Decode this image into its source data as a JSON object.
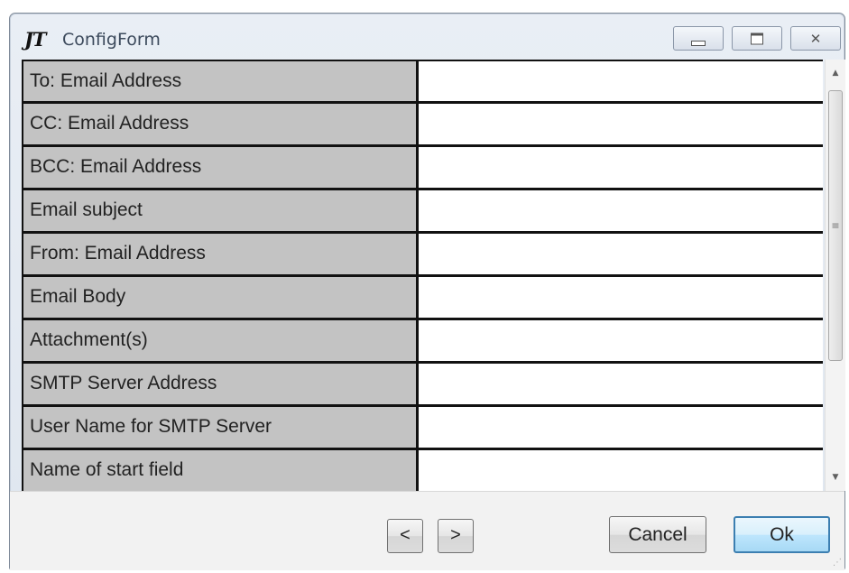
{
  "window": {
    "logo": "JT",
    "title": "ConfigForm",
    "controls": {
      "minimize": "minimize-icon",
      "maximize": "maximize-icon",
      "close": "✕"
    }
  },
  "grid": {
    "rows": [
      {
        "label": "To: Email Address",
        "value": ""
      },
      {
        "label": "CC: Email Address",
        "value": ""
      },
      {
        "label": "BCC: Email Address",
        "value": ""
      },
      {
        "label": "Email subject",
        "value": ""
      },
      {
        "label": "From: Email Address",
        "value": ""
      },
      {
        "label": "Email Body",
        "value": ""
      },
      {
        "label": "Attachment(s)",
        "value": ""
      },
      {
        "label": "SMTP Server Address",
        "value": ""
      },
      {
        "label": "User Name for SMTP Server",
        "value": ""
      },
      {
        "label": "Name of start field",
        "value": ""
      }
    ]
  },
  "scrollbar": {
    "up_arrow": "▲",
    "down_arrow": "▼",
    "grip": "≡",
    "scroll_position": 0.0
  },
  "footer": {
    "prev_label": "<",
    "next_label": ">",
    "cancel_label": "Cancel",
    "ok_label": "Ok"
  },
  "colors": {
    "label_bg": "#c3c3c3",
    "grid_lines": "#111111",
    "ok_border": "#3c7fb1",
    "logo_red": "#d21515"
  }
}
